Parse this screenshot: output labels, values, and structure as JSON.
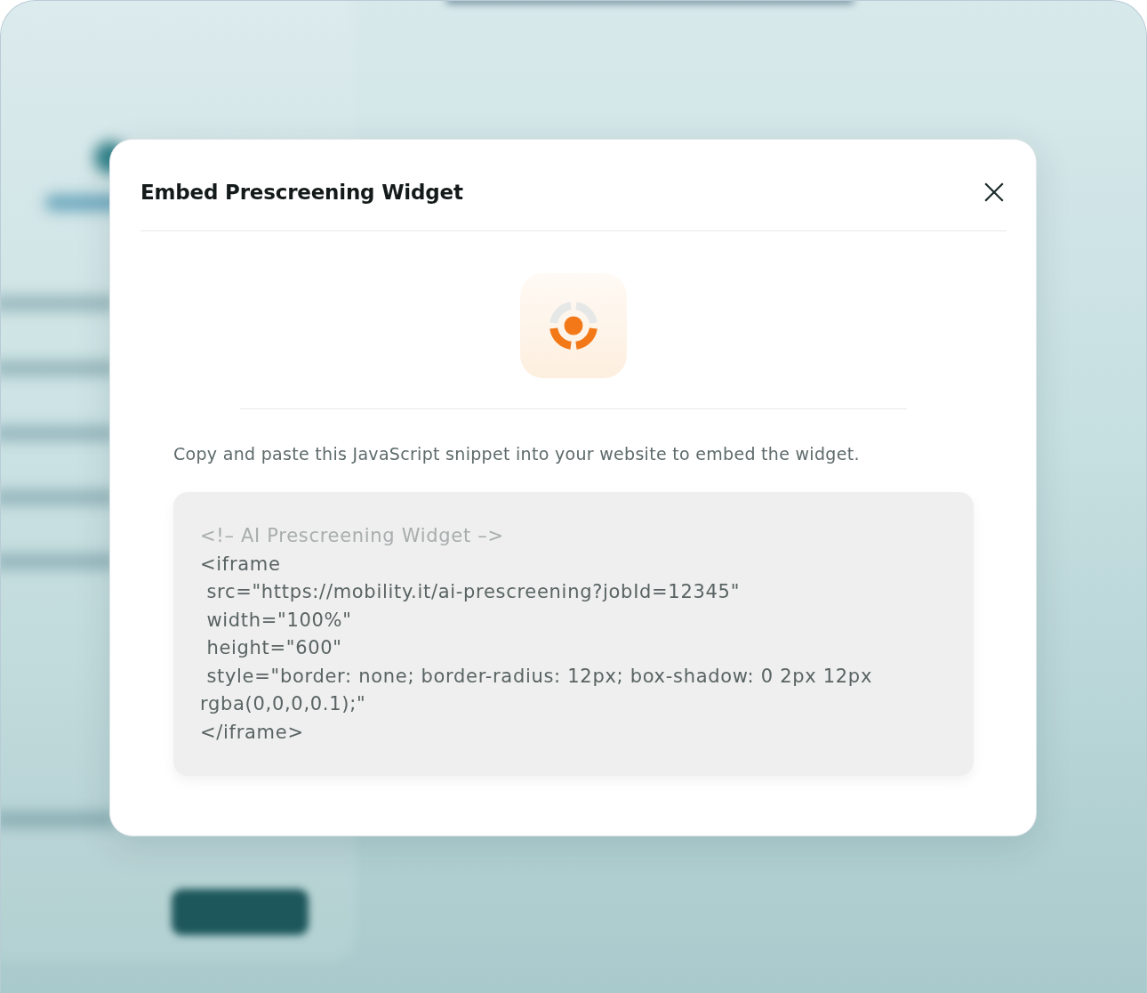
{
  "dialog": {
    "title": "Embed Prescreening Widget",
    "instructions": "Copy and paste this JavaScript snippet into your website to embed the widget.",
    "snippet": {
      "lines": [
        {
          "kind": "comment",
          "text": "<!– AI Prescreening Widget –>"
        },
        {
          "kind": "code",
          "text": "<iframe"
        },
        {
          "kind": "code",
          "text": " src=\"https://mobility.it/ai-prescreening?jobId=12345\""
        },
        {
          "kind": "code",
          "text": " width=\"100%\""
        },
        {
          "kind": "code",
          "text": " height=\"600\""
        },
        {
          "kind": "code",
          "text": " style=\"border: none; border-radius: 12px; box-shadow: 0 2px 12px"
        },
        {
          "kind": "code",
          "text": "rgba(0,0,0,0.1);\""
        },
        {
          "kind": "code",
          "text": "</iframe>"
        }
      ]
    }
  }
}
